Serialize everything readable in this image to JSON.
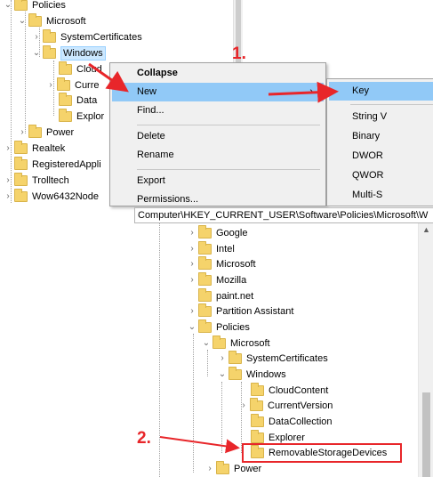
{
  "top_tree": {
    "items": [
      {
        "label": "Policies"
      },
      {
        "label": "Microsoft"
      },
      {
        "label": "SystemCertificates"
      },
      {
        "label": "Windows"
      },
      {
        "label": "Cloud"
      },
      {
        "label": "Curre"
      },
      {
        "label": "Data"
      },
      {
        "label": "Explor"
      },
      {
        "label": "Power"
      },
      {
        "label": "Realtek"
      },
      {
        "label": "RegisteredAppli"
      },
      {
        "label": "Trolltech"
      },
      {
        "label": "Wow6432Node"
      }
    ]
  },
  "context_menu": {
    "items": [
      {
        "label": "Collapse"
      },
      {
        "label": "New"
      },
      {
        "label": "Find..."
      },
      {
        "label": "Delete"
      },
      {
        "label": "Rename"
      },
      {
        "label": "Export"
      },
      {
        "label": "Permissions..."
      }
    ],
    "submenu_arrow": "›"
  },
  "submenu": {
    "items": [
      {
        "label": "Key"
      },
      {
        "label": "String V"
      },
      {
        "label": "Binary"
      },
      {
        "label": "DWOR"
      },
      {
        "label": "QWOR"
      },
      {
        "label": "Multi-S"
      }
    ]
  },
  "address_bar": {
    "path": "Computer\\HKEY_CURRENT_USER\\Software\\Policies\\Microsoft\\W"
  },
  "bottom_tree": {
    "items": [
      {
        "label": "Google"
      },
      {
        "label": "Intel"
      },
      {
        "label": "Microsoft"
      },
      {
        "label": "Mozilla"
      },
      {
        "label": "paint.net"
      },
      {
        "label": "Partition Assistant"
      },
      {
        "label": "Policies"
      },
      {
        "label": "Microsoft"
      },
      {
        "label": "SystemCertificates"
      },
      {
        "label": "Windows"
      },
      {
        "label": "CloudContent"
      },
      {
        "label": "CurrentVersion"
      },
      {
        "label": "DataCollection"
      },
      {
        "label": "Explorer"
      },
      {
        "label": "RemovableStorageDevices"
      },
      {
        "label": "Power"
      }
    ]
  },
  "annotations": {
    "step1": "1.",
    "step2": "2.",
    "color": "#e8262a"
  },
  "colors": {
    "menu_highlight": "#91c9f7",
    "selection": "#cce8ff",
    "folder": "#f5d36b"
  }
}
